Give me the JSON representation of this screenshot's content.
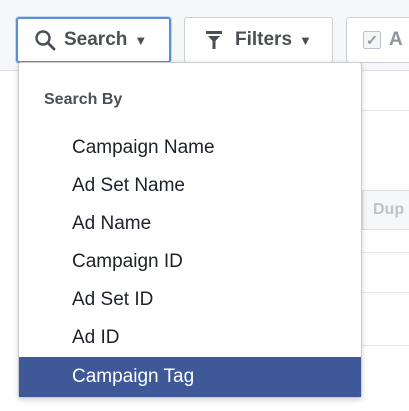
{
  "toolbar": {
    "search_label": "Search",
    "filters_label": "Filters",
    "third_label": "A"
  },
  "dropdown": {
    "header": "Search By",
    "items": [
      {
        "label": "Campaign Name",
        "selected": false
      },
      {
        "label": "Ad Set Name",
        "selected": false
      },
      {
        "label": "Ad Name",
        "selected": false
      },
      {
        "label": "Campaign ID",
        "selected": false
      },
      {
        "label": "Ad Set ID",
        "selected": false
      },
      {
        "label": "Ad ID",
        "selected": false
      },
      {
        "label": "Campaign Tag",
        "selected": true
      }
    ]
  },
  "background": {
    "partial_button_label": "Dup"
  },
  "colors": {
    "selected_bg": "#3f5998",
    "focus_border": "#5b8fd9"
  }
}
